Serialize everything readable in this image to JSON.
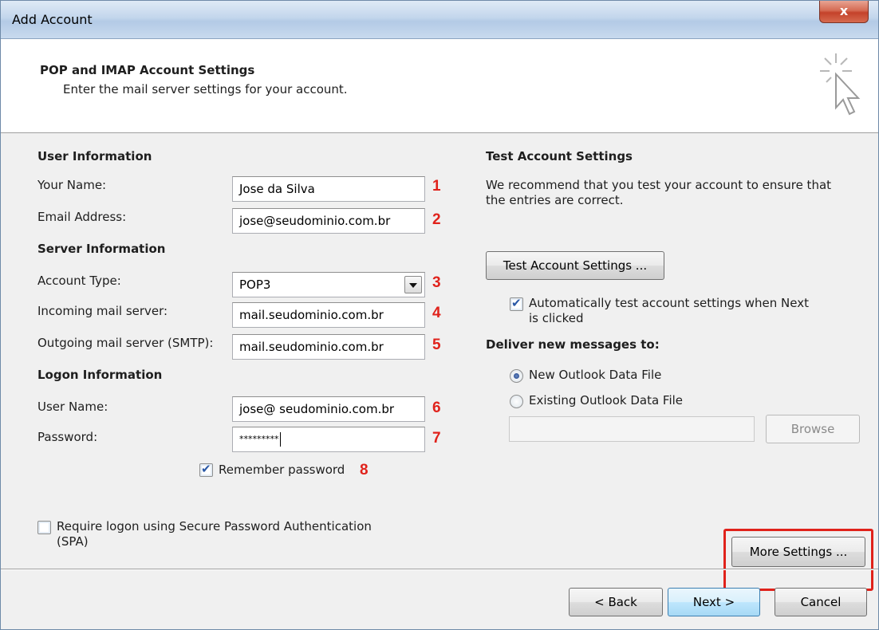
{
  "window": {
    "title": "Add Account",
    "close_glyph": "x"
  },
  "header": {
    "title": "POP and IMAP Account Settings",
    "subtitle": "Enter the mail server settings for your account.",
    "icon": "wizard-cursor-icon"
  },
  "user_info": {
    "section": "User Information",
    "your_name_label": "Your Name:",
    "your_name_value": "Jose da Silva",
    "email_label": "Email Address:",
    "email_value": "jose@seudominio.com.br"
  },
  "server_info": {
    "section": "Server Information",
    "account_type_label": "Account Type:",
    "account_type_value": "POP3",
    "incoming_label": "Incoming mail server:",
    "incoming_value": "mail.seudominio.com.br",
    "outgoing_label": "Outgoing mail server (SMTP):",
    "outgoing_value": "mail.seudominio.com.br"
  },
  "logon_info": {
    "section": "Logon Information",
    "username_label": "User Name:",
    "username_value": "jose@ seudominio.com.br",
    "password_label": "Password:",
    "password_value": "*********",
    "remember_label": "Remember password",
    "remember_checked": true,
    "spa_label_line1": "Require logon using Secure Password Authentication",
    "spa_label_line2": "(SPA)",
    "spa_checked": false
  },
  "markers": [
    "1",
    "2",
    "3",
    "4",
    "5",
    "6",
    "7",
    "8"
  ],
  "test_settings": {
    "section": "Test Account Settings",
    "description_line1": "We recommend that you test your account to ensure that",
    "description_line2": "the entries are correct.",
    "button": "Test Account Settings ...",
    "auto_test_line1": "Automatically test account settings when Next",
    "auto_test_line2": "is clicked",
    "auto_test_checked": true
  },
  "deliver": {
    "section": "Deliver new messages to:",
    "option_new": "New Outlook Data File",
    "option_existing": "Existing Outlook Data File",
    "selected": "new",
    "browse_button": "Browse"
  },
  "more_settings_button": "More Settings ...",
  "footer": {
    "back": "< Back",
    "next": "Next >",
    "cancel": "Cancel"
  },
  "colors": {
    "marker": "#e0221b",
    "highlight": "#e0221b"
  }
}
